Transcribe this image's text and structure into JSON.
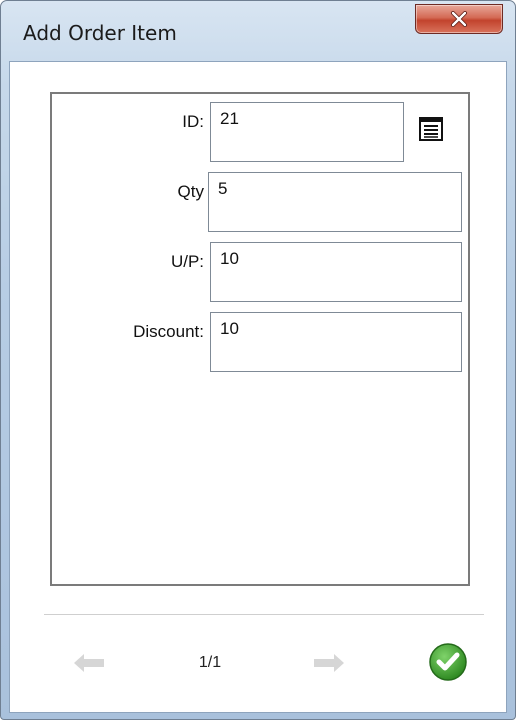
{
  "window": {
    "title": "Add Order Item",
    "close_icon": "close-icon",
    "close_color": "#c7432f"
  },
  "form": {
    "fields": [
      {
        "key": "id",
        "label": "ID:",
        "value": "21"
      },
      {
        "key": "qty",
        "label": "Qty",
        "value": "5"
      },
      {
        "key": "up",
        "label": "U/P:",
        "value": "10"
      },
      {
        "key": "discount",
        "label": "Discount:",
        "value": "10"
      }
    ],
    "lookup_icon": "list-lookup-icon"
  },
  "footer": {
    "prev_icon": "arrow-left-icon",
    "next_icon": "arrow-right-icon",
    "page_indicator": "1/1",
    "confirm_icon": "check-circle-icon",
    "confirm_color": "#3a9a2a"
  }
}
